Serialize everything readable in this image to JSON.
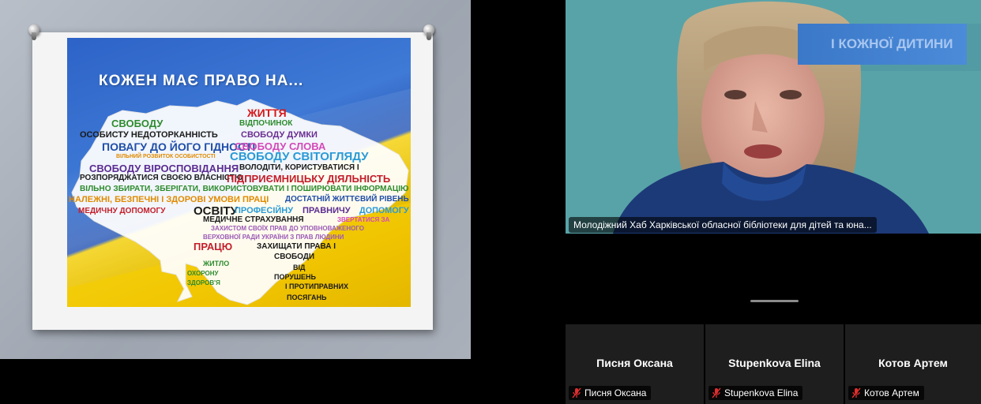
{
  "shared_screen": {
    "poster": {
      "title": "КОЖЕН МАЄ ПРАВО НА...",
      "words": [
        {
          "text": "ЖИТТЯ",
          "color": "#d6191c"
        },
        {
          "text": "ВІДПОЧИНОК",
          "color": "#2e8b2e"
        },
        {
          "text": "СВОБОДУ",
          "color": "#2e8b2e"
        },
        {
          "text": "ОСОБИСТУ НЕДОТОРКАННІСТЬ",
          "color": "#1a1a1a"
        },
        {
          "text": "СВОБОДУ  ДУМКИ",
          "color": "#6a2c91"
        },
        {
          "text": "ПОВАГУ ДО ЙОГО ГІДНОСТІ",
          "color": "#1f4ea8"
        },
        {
          "text": "СВОБОДУ  СЛОВА",
          "color": "#d44ab8"
        },
        {
          "text": "ВІЛЬНИЙ РОЗВИТОК ОСОБИСТОСТІ",
          "color": "#e08a00"
        },
        {
          "text": "СВОБОДУ СВІТОГЛЯДУ",
          "color": "#2a9ad6"
        },
        {
          "text": "СВОБОДУ  ВІРОСПОВІДАННЯ",
          "color": "#5b2c91"
        },
        {
          "text": "ВОЛОДІТИ,  КОРИСТУВАТИСЯ  І",
          "color": "#1a1a1a"
        },
        {
          "text": "РОЗПОРЯДЖАТИСЯ  СВОЄЮ  ВЛАСНІСТЮ",
          "color": "#1a1a1a"
        },
        {
          "text": "ПІДПРИЄМНИЦЬКУ  ДІЯЛЬНІСТЬ",
          "color": "#c21e2a"
        },
        {
          "text": "ВІЛЬНО  ЗБИРАТИ,  ЗБЕРІГАТИ,  ВИКОРИСТОВУВАТИ  І  ПОШИРЮВАТИ  ІНФОРМАЦІЮ",
          "color": "#2e8b2e"
        },
        {
          "text": "НАЛЕЖНІ,  БЕЗПЕЧНІ  І  ЗДОРОВІ  УМОВИ  ПРАЦІ",
          "color": "#e08a00"
        },
        {
          "text": "ДОСТАТНІЙ  ЖИТТЄВИЙ  РІВЕНЬ",
          "color": "#1f4ea8"
        },
        {
          "text": "МЕДИЧНУ  ДОПОМОГУ",
          "color": "#c21e2a"
        },
        {
          "text": "ОСВІТУ",
          "color": "#1a1a1a"
        },
        {
          "text": "ПРОФЕСІЙНУ",
          "color": "#2a9ad6"
        },
        {
          "text": "ПРАВНИЧУ",
          "color": "#5b2c91"
        },
        {
          "text": "ДОПОМОГУ",
          "color": "#2a9ad6"
        },
        {
          "text": "МЕДИЧНЕ   СТРАХУВАННЯ",
          "color": "#1a1a1a"
        },
        {
          "text": "ЗВЕРТАТИСЯ  ЗА",
          "color": "#d44ab8"
        },
        {
          "text": "ЗАХИСТОМ  СВОЇХ  ПРАВ  ДО  УПОВНОВАЖЕНОГО",
          "color": "#9b59b6"
        },
        {
          "text": "ВЕРХОВНОЇ  РАДИ  УКРАЇНИ  З  ПРАВ  ЛЮДИНИ",
          "color": "#9b59b6"
        },
        {
          "text": "ПРАЦЮ",
          "color": "#c21e2a"
        },
        {
          "text": "ЗАХИЩАТИ   ПРАВА   І",
          "color": "#1a1a1a"
        },
        {
          "text": "СВОБОДИ",
          "color": "#1a1a1a"
        },
        {
          "text": "ЖИТЛО",
          "color": "#2e8b2e"
        },
        {
          "text": "ВІД",
          "color": "#1a1a1a"
        },
        {
          "text": "ОХОРОНУ",
          "color": "#2e8b2e"
        },
        {
          "text": "ПОРУШЕНЬ",
          "color": "#1a1a1a"
        },
        {
          "text": "ЗДОРОВ'Я",
          "color": "#2e8b2e"
        },
        {
          "text": "І  ПРОТИПРАВНИХ",
          "color": "#1a1a1a"
        },
        {
          "text": "ПОСЯГАНЬ",
          "color": "#1a1a1a"
        }
      ]
    }
  },
  "video": {
    "participant_name": "Молодіжний Хаб Харківської обласної бібліотеки для дітей та юна...",
    "background_banner_text": "І КОЖНОЇ ДИТИНИ"
  },
  "participants": [
    {
      "name": "Писня Оксана",
      "label": "Писня Оксана",
      "muted_icon": "mic-muted-icon"
    },
    {
      "name": "Stupenkova Elina",
      "label": "Stupenkova Elina",
      "muted_icon": "mic-muted-icon"
    },
    {
      "name": "Котов Артем",
      "label": "Котов Артем",
      "muted_icon": "mic-muted-icon"
    }
  ],
  "colors": {
    "muted_red": "#e02e2e",
    "tile_bg": "#1e1e1e"
  }
}
